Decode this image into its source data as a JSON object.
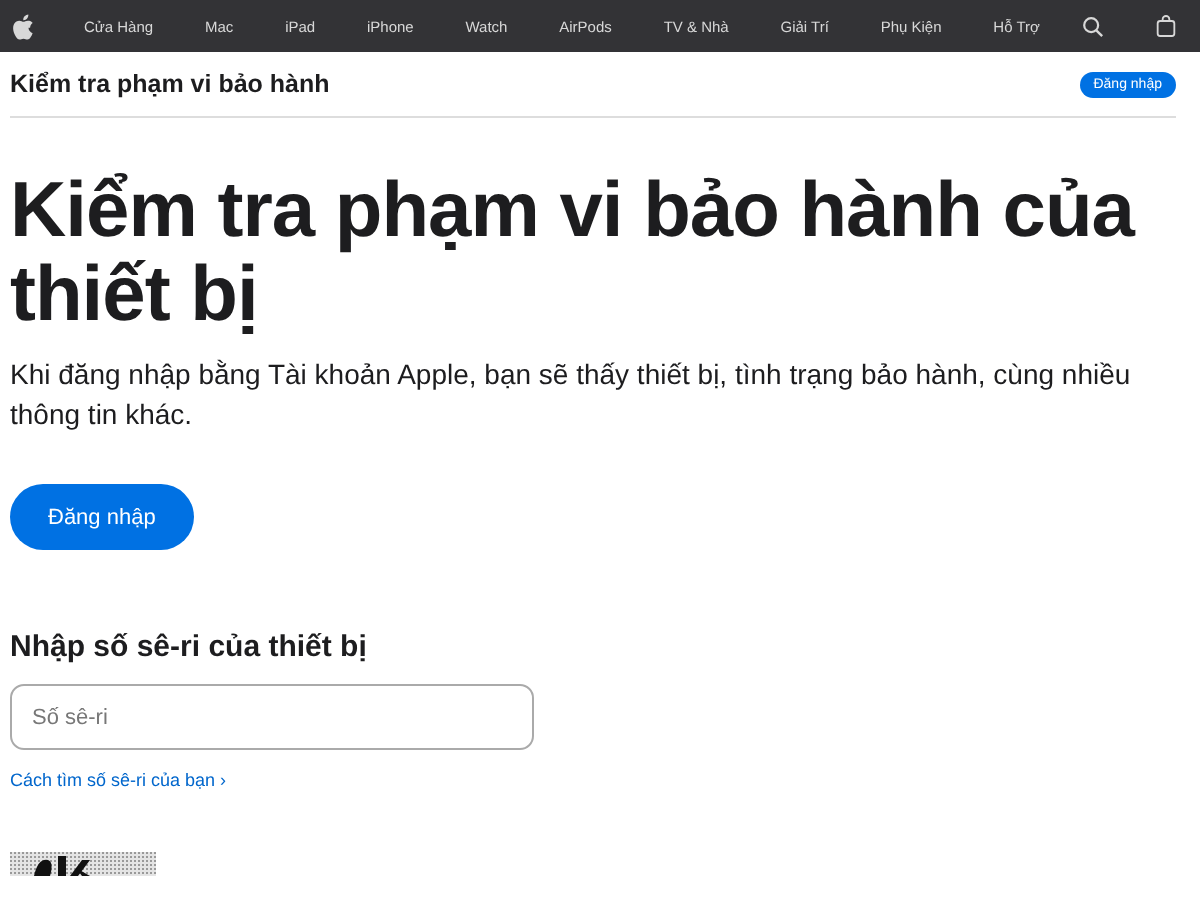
{
  "nav": {
    "items": [
      "Cửa Hàng",
      "Mac",
      "iPad",
      "iPhone",
      "Watch",
      "AirPods",
      "TV & Nhà",
      "Giải Trí",
      "Phụ Kiện",
      "Hỗ Trợ"
    ]
  },
  "subheader": {
    "title": "Kiểm tra phạm vi bảo hành",
    "button": "Đăng nhập"
  },
  "heading": "Kiểm tra phạm vi bảo hành của thiết bị",
  "intro": "Khi đăng nhập bằng Tài khoản Apple, bạn sẽ thấy thiết bị, tình trạng bảo hành, cùng nhiều thông tin khác.",
  "signin_button": "Đăng nhập",
  "serial": {
    "label": "Nhập số sê-ri của thiết bị",
    "placeholder": "Số sê-ri",
    "help_link": "Cách tìm số sê-ri của bạn ›"
  }
}
